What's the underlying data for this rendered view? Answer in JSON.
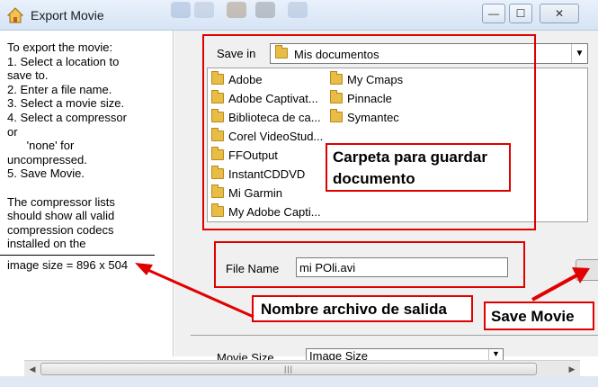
{
  "window": {
    "title": "Export Movie",
    "minimize_glyph": "—",
    "maximize_glyph": "☐",
    "close_glyph": "✕"
  },
  "help_panel": {
    "lines": [
      "To export the movie:",
      " 1. Select a location to",
      "save to.",
      " 2. Enter a file name.",
      " 3. Select a movie size.",
      " 4. Select a compressor",
      "or",
      "      'none' for",
      "uncompressed.",
      " 5. Save Movie.",
      "",
      "The compressor lists",
      "should show all valid",
      "compression codecs",
      "installed on the"
    ],
    "image_size": "image size = 896 x 504"
  },
  "save_in": {
    "label": "Save in",
    "value": "Mis documentos"
  },
  "files": [
    "Adobe",
    "Adobe Captivat...",
    "Biblioteca de ca...",
    "Corel VideoStud...",
    "FFOutput",
    "InstantCDDVD",
    "Mi Garmin",
    "My Adobe Capti...",
    "My Cmaps",
    "Pinnacle",
    "Symantec"
  ],
  "file_name": {
    "label": "File Name",
    "value": "mi POli.avi"
  },
  "movie_size": {
    "label": "Movie Size",
    "value": "Image Size"
  },
  "scrollbar": {
    "left_arrow": "◀",
    "right_arrow": "▶",
    "grip": "|||"
  },
  "annotations": {
    "folder_note": "Carpeta para guardar documento",
    "output_note": "Nombre archivo de salida",
    "save_note": "Save Movie",
    "color": "#e00000"
  }
}
